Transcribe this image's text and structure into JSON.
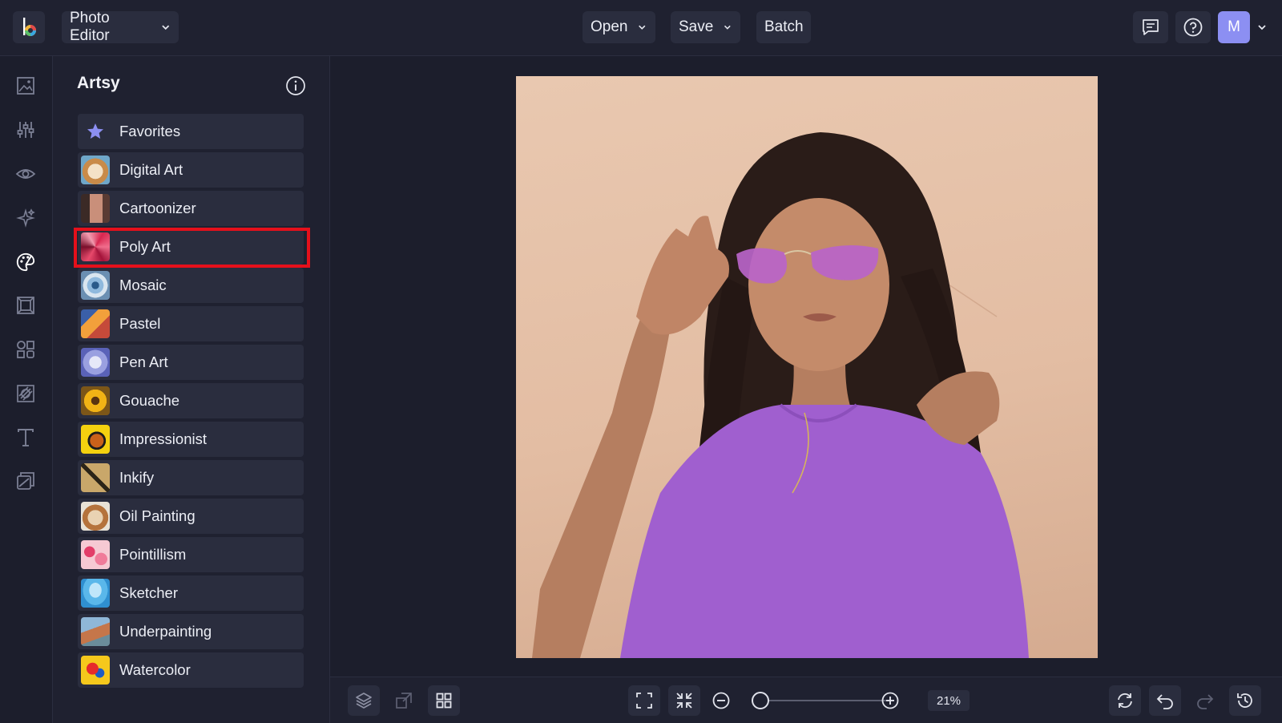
{
  "header": {
    "app_menu_label": "Photo Editor",
    "open_label": "Open",
    "save_label": "Save",
    "batch_label": "Batch",
    "avatar_initial": "M"
  },
  "rail": {
    "items": [
      "image-icon",
      "sliders-icon",
      "eye-icon",
      "sparkles-icon",
      "palette-icon",
      "frame-icon",
      "shapes-icon",
      "texture-icon",
      "text-icon",
      "overlay-icon"
    ],
    "active_item": "palette-icon"
  },
  "panel": {
    "title": "Artsy",
    "effects": [
      {
        "label": "Favorites",
        "thumb": "star-icon"
      },
      {
        "label": "Digital Art",
        "thumb": "dog"
      },
      {
        "label": "Cartoonizer",
        "thumb": "face"
      },
      {
        "label": "Poly Art",
        "thumb": "rose"
      },
      {
        "label": "Mosaic",
        "thumb": "eye"
      },
      {
        "label": "Pastel",
        "thumb": "flower"
      },
      {
        "label": "Pen Art",
        "thumb": "animal"
      },
      {
        "label": "Gouache",
        "thumb": "sunflower"
      },
      {
        "label": "Impressionist",
        "thumb": "fruit"
      },
      {
        "label": "Inkify",
        "thumb": "butterfly"
      },
      {
        "label": "Oil Painting",
        "thumb": "dog"
      },
      {
        "label": "Pointillism",
        "thumb": "flowers"
      },
      {
        "label": "Sketcher",
        "thumb": "jellyfish"
      },
      {
        "label": "Underpainting",
        "thumb": "mountain"
      },
      {
        "label": "Watercolor",
        "thumb": "parrot"
      }
    ],
    "highlighted_effect": "Poly Art"
  },
  "canvas": {
    "photo_description_icon": "portrait-photo"
  },
  "bottombar": {
    "zoom_label": "21%",
    "zoom_level": 0.21
  },
  "colors": {
    "accent": "#8c8ff2",
    "highlight": "#e5101b",
    "background": "#1c1e2c",
    "panel": "#1f2130",
    "button": "#2a2d3e"
  }
}
